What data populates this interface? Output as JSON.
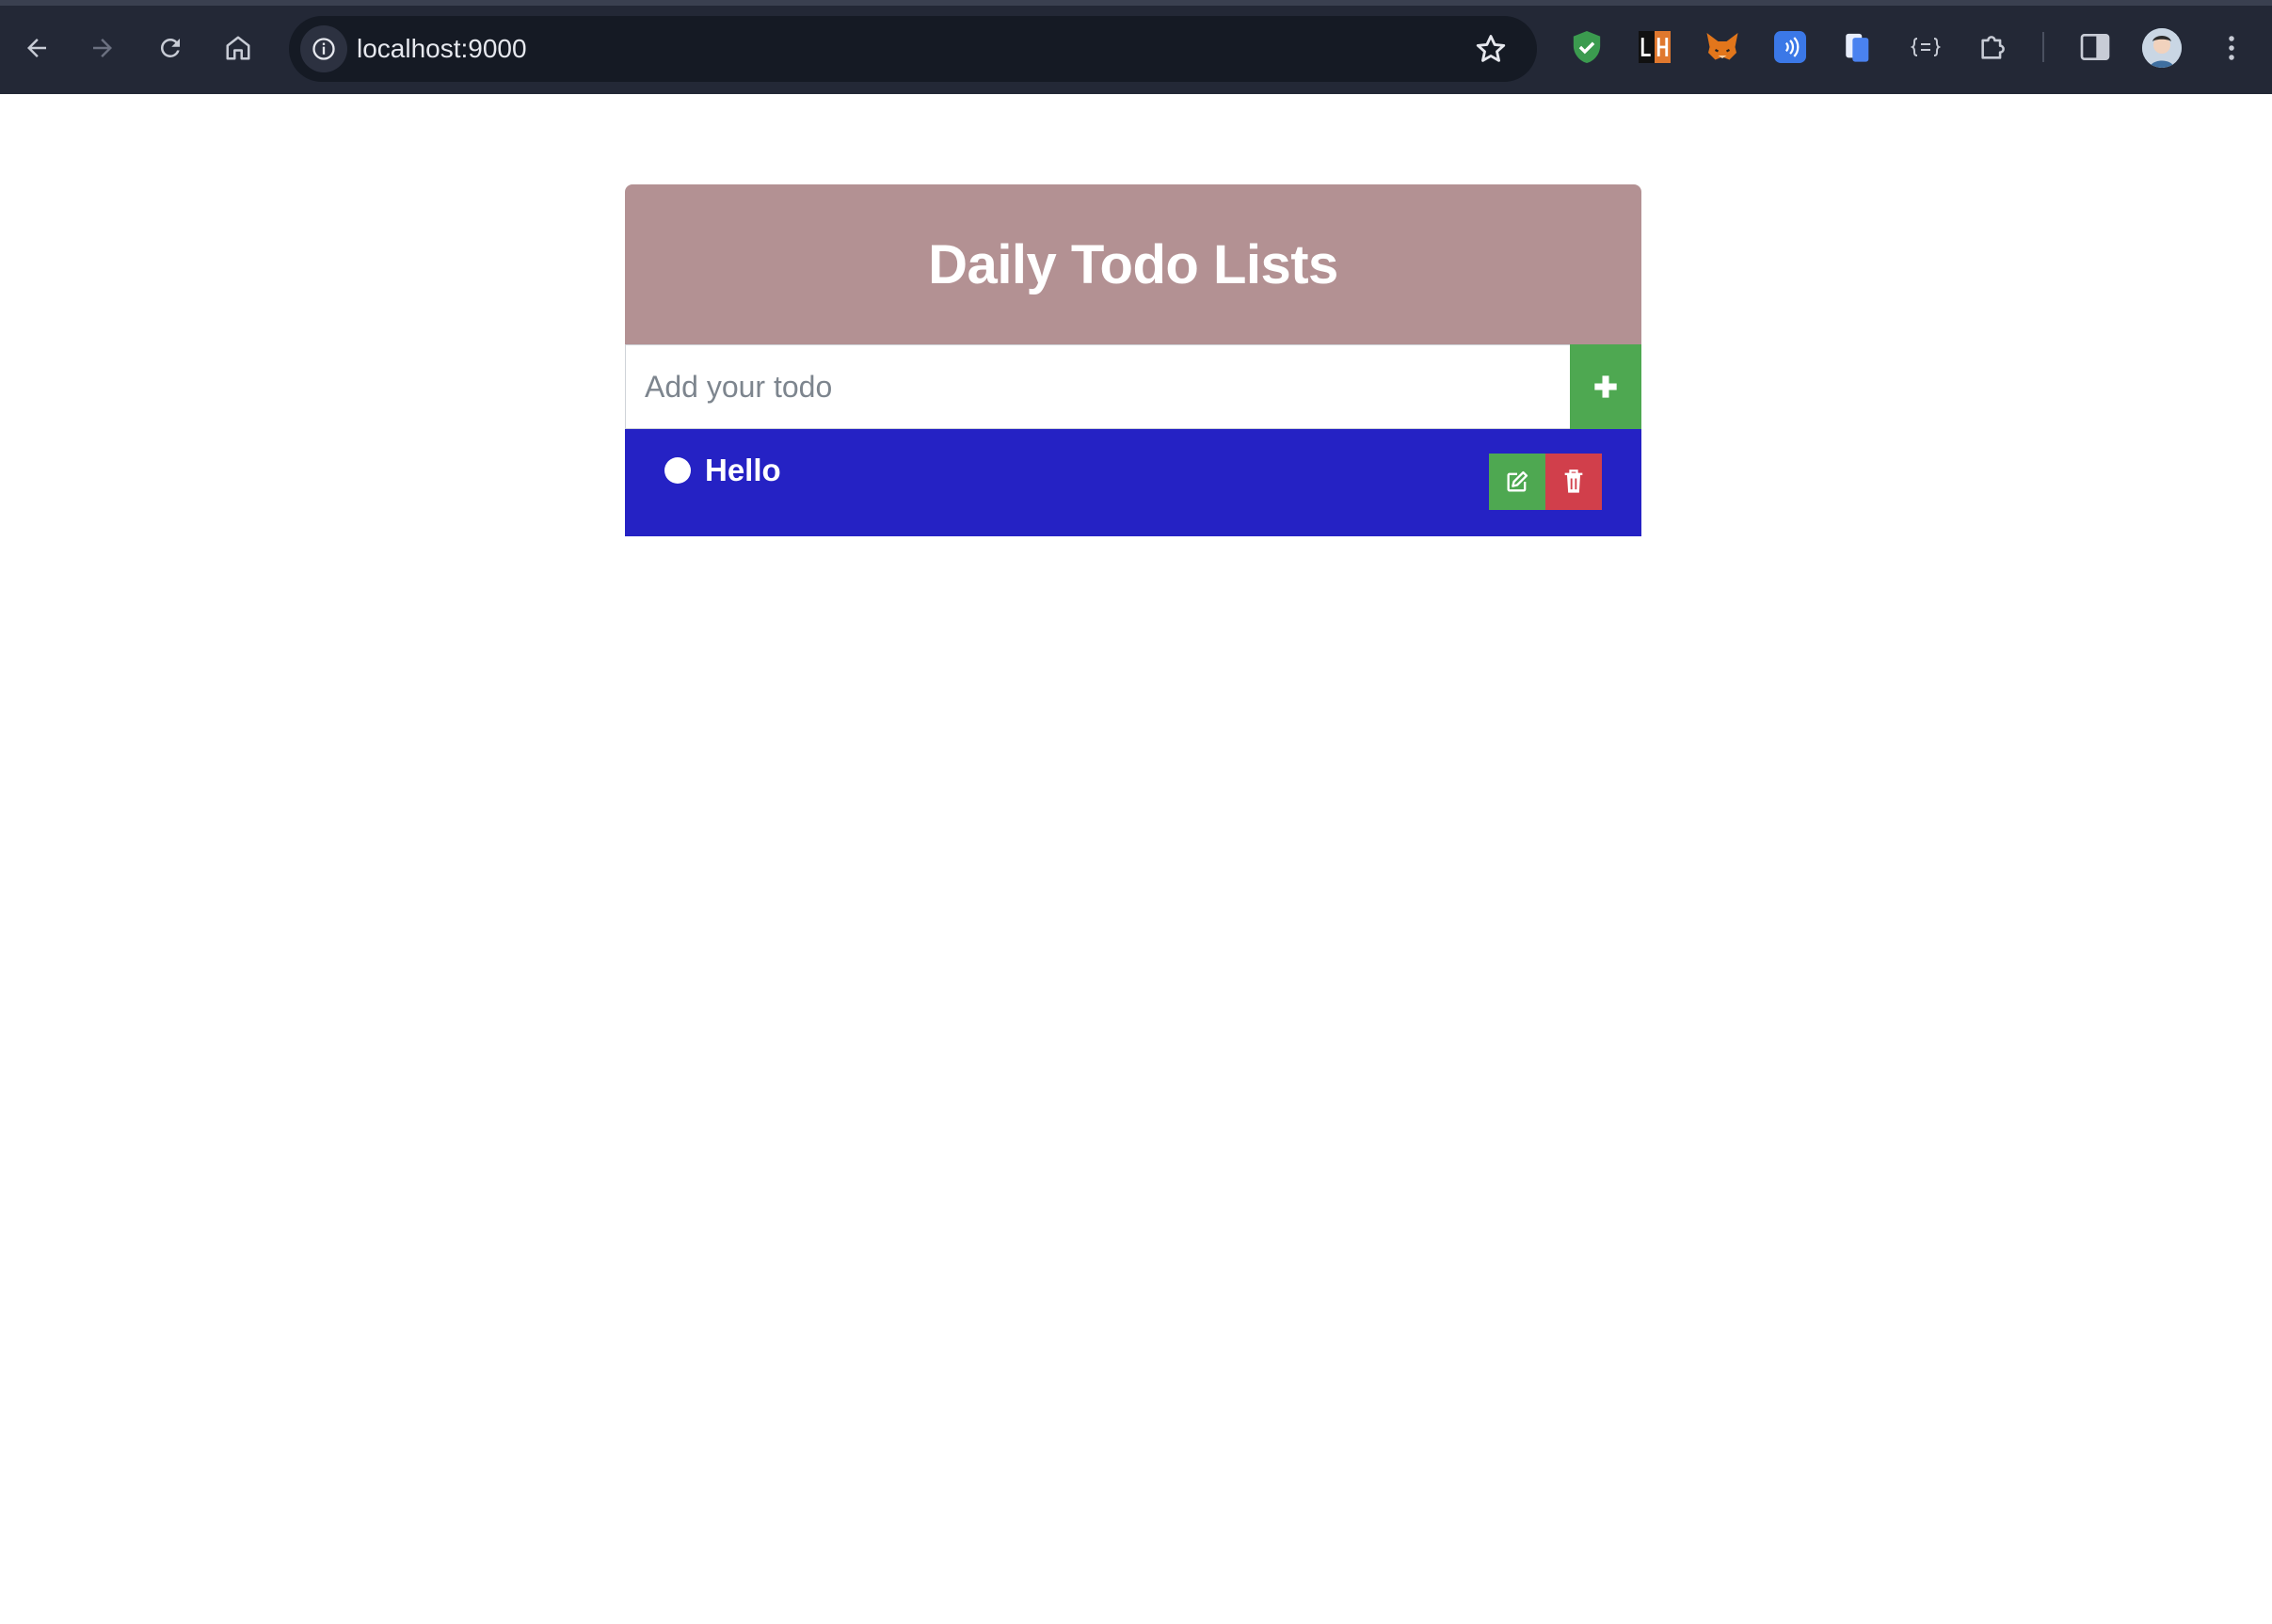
{
  "browser": {
    "url": "localhost:9000",
    "nav": {
      "back_icon": "arrow-left-icon",
      "forward_icon": "arrow-right-icon",
      "reload_icon": "reload-icon",
      "home_icon": "home-icon"
    },
    "extensions": [
      "shield-check-icon",
      "lh-extension-icon",
      "fox-extension-icon",
      "nfc-extension-icon",
      "clipboard-extension-icon",
      "json-extension-icon",
      "puzzle-icon"
    ],
    "colors": {
      "chrome_bg": "#232836",
      "omnibox_bg": "#151a24"
    }
  },
  "app": {
    "title": "Daily Todo Lists",
    "input_placeholder": "Add your todo",
    "add_button_icon": "plus-icon",
    "colors": {
      "header": "#b39193",
      "add_button": "#4ea851",
      "item_bg": "#2522c4",
      "edit_button": "#4ea851",
      "delete_button": "#d13f4b"
    },
    "todos": [
      {
        "text": "Hello",
        "edit_icon": "edit-icon",
        "delete_icon": "trash-icon"
      }
    ]
  }
}
